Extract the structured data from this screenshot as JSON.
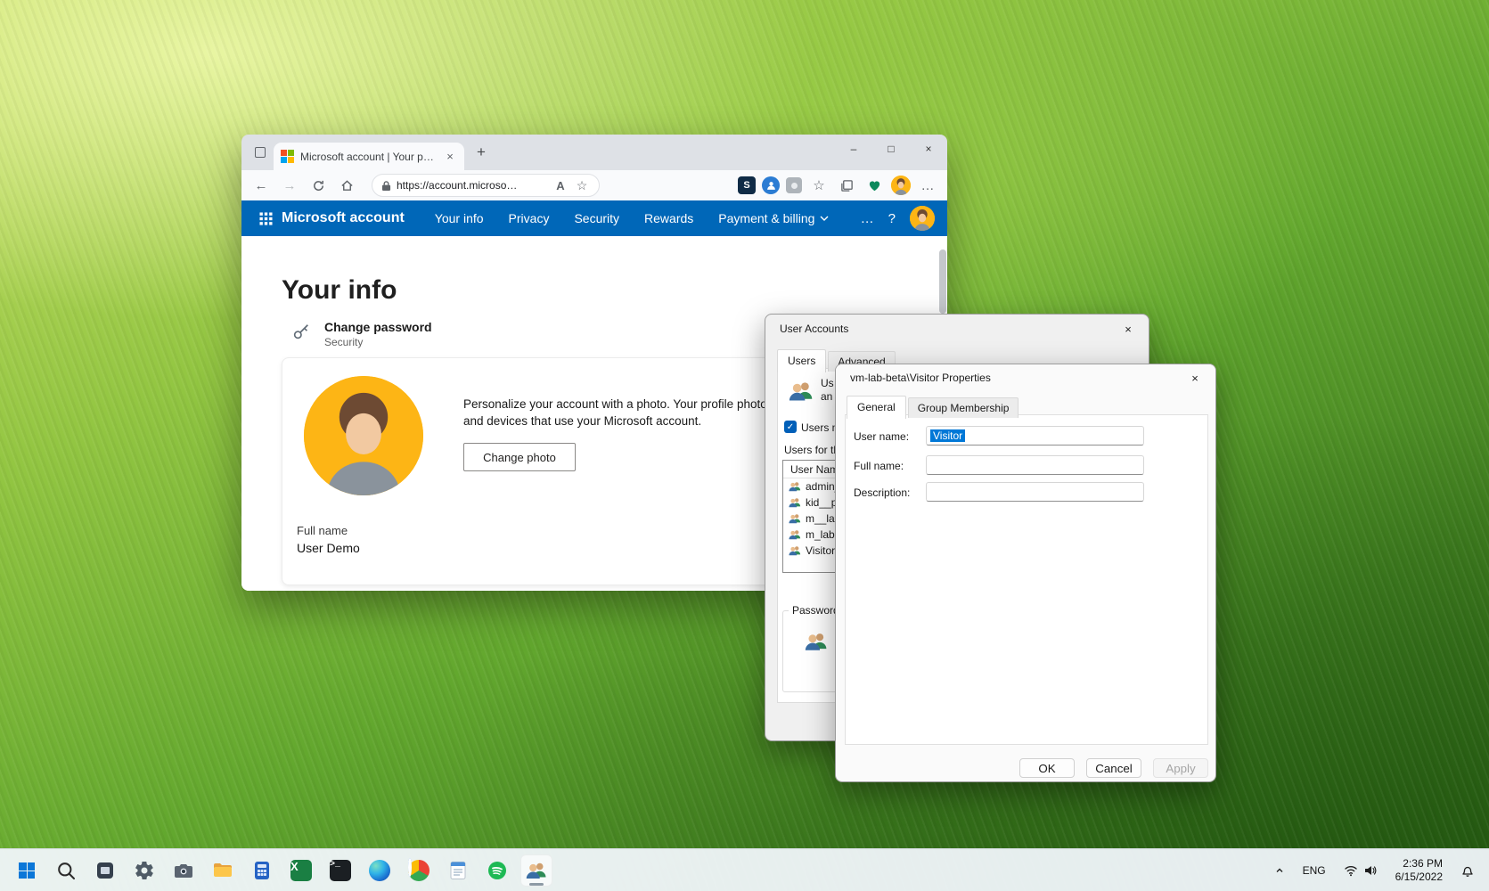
{
  "glyphs": {
    "back": "←",
    "forward": "→",
    "new_tab": "+",
    "close": "×",
    "minimize": "–",
    "maximize": "□",
    "more": "…",
    "help": "?",
    "read_aloud": "A",
    "ext_s": "S",
    "star_outline": "☆",
    "check": "✓",
    "terminal_prompt": ">_",
    "excel_x": "X"
  },
  "browser": {
    "tab_title": "Microsoft account | Your profile",
    "url": "https://account.microso…"
  },
  "account_page": {
    "brand": "Microsoft account",
    "nav": [
      "Your info",
      "Privacy",
      "Security",
      "Rewards",
      "Payment & billing"
    ],
    "heading": "Your info",
    "change_password_title": "Change password",
    "change_password_subtitle": "Security",
    "photo_line1": "Personalize your account with a photo. Your profile photo w",
    "photo_line2": "and devices that use your Microsoft account.",
    "change_photo_button": "Change photo",
    "full_name_label": "Full name",
    "full_name_value": "User Demo"
  },
  "user_accounts": {
    "title": "User Accounts",
    "tab_users": "Users",
    "tab_advanced": "Advanced",
    "intro_line1": "Us",
    "intro_line2": "an",
    "checkbox_label": "Users mu",
    "list_label": "Users for thi",
    "column_user_name": "User Name",
    "users": [
      "admin_",
      "kid__pa",
      "m__lab",
      "m_lab.",
      "Visitor"
    ],
    "password_group": "Password"
  },
  "properties": {
    "title": "vm-lab-beta\\Visitor Properties",
    "tab_general": "General",
    "tab_group": "Group Membership",
    "user_name_label": "User name:",
    "user_name_value": "Visitor",
    "full_name_label": "Full name:",
    "full_name_value": "",
    "description_label": "Description:",
    "description_value": "",
    "ok": "OK",
    "cancel": "Cancel",
    "apply": "Apply"
  },
  "taskbar": {
    "language": "ENG",
    "time": "2:36 PM",
    "date": "6/15/2022"
  }
}
